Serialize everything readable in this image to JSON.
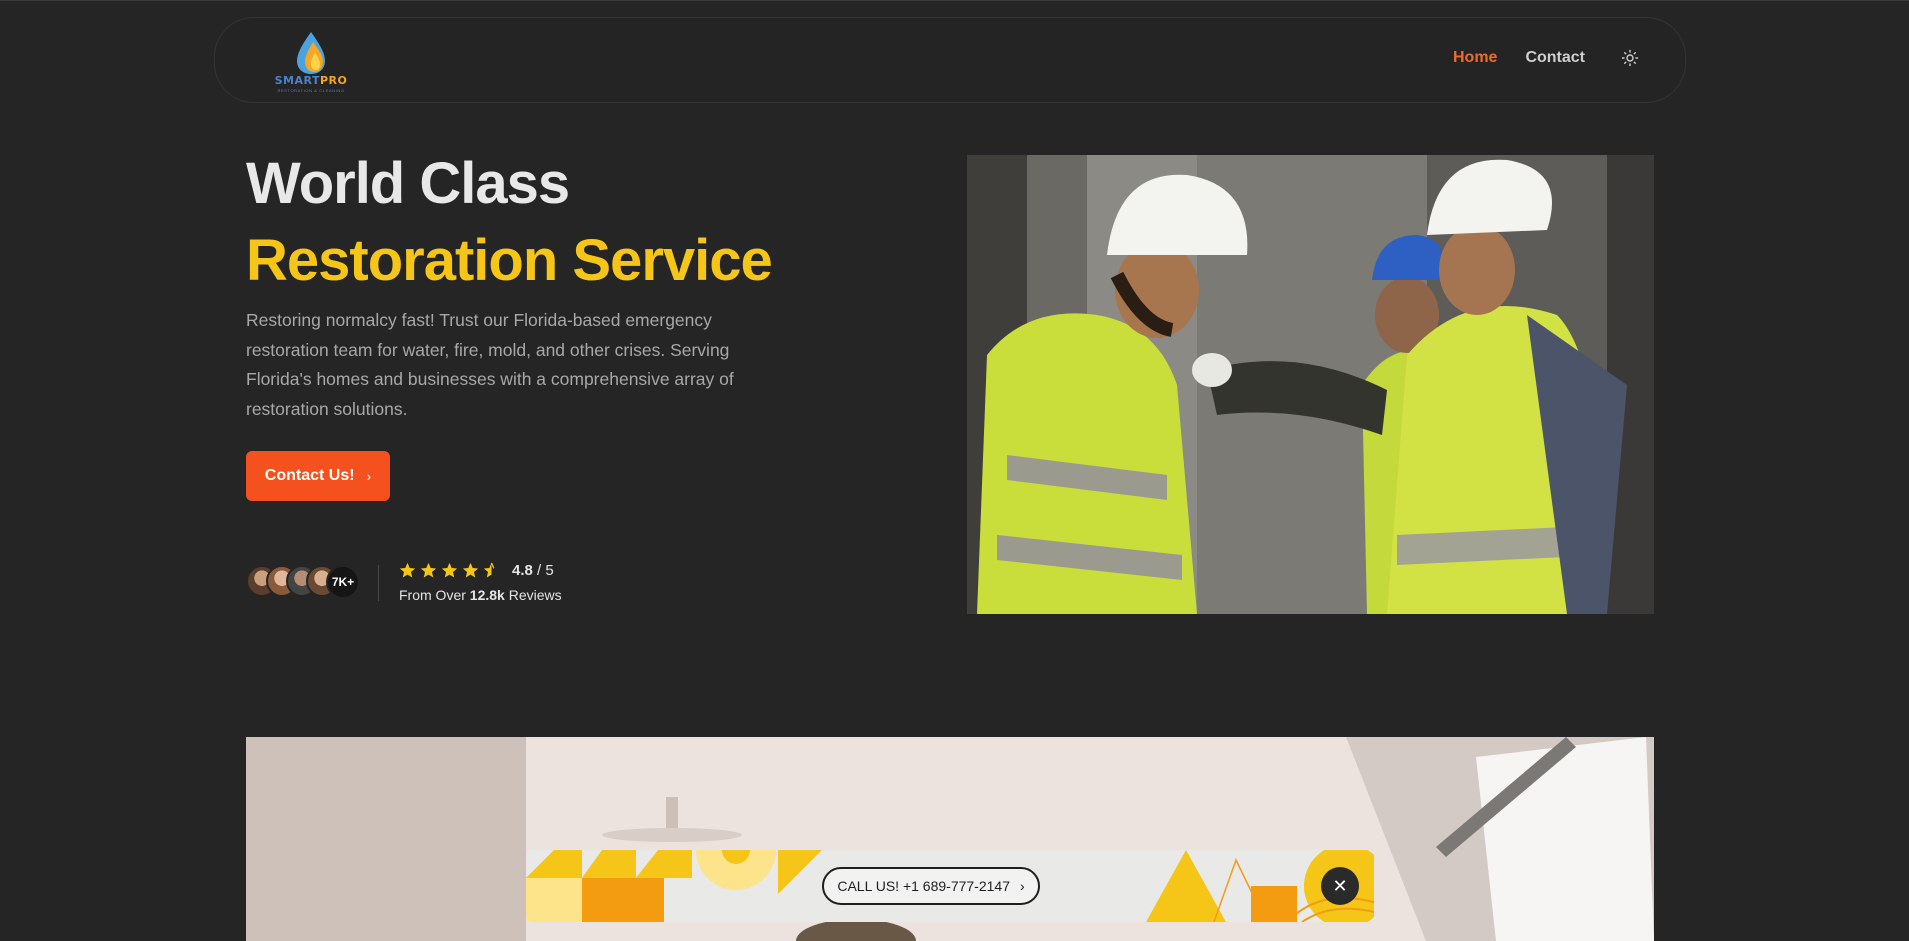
{
  "nav": {
    "logo_text_a": "SMART",
    "logo_text_b": "PRO",
    "logo_sub": "RESTORATION & CLEANING",
    "home_label": "Home",
    "contact_label": "Contact",
    "theme_icon": "sun-icon"
  },
  "hero": {
    "title_line1": "World Class",
    "title_line2": "Restoration Service",
    "description": "Restoring normalcy fast! Trust our Florida-based emergency restoration team for water, fire, mold, and other crises. Serving Florida's homes and businesses with a comprehensive array of restoration solutions.",
    "cta_label": "Contact Us!",
    "avatar_count": "7K+",
    "rating_value": "4.8",
    "rating_max": "/ 5",
    "reviews_prefix": "From Over",
    "reviews_count": "12.8k",
    "reviews_suffix": "Reviews",
    "stars": 4.5
  },
  "banner": {
    "call_label": "CALL US! +1 689-777-2147",
    "close_icon": "close-icon"
  },
  "colors": {
    "accent_orange": "#f4511e",
    "accent_yellow": "#f5c518",
    "background": "#252525"
  }
}
